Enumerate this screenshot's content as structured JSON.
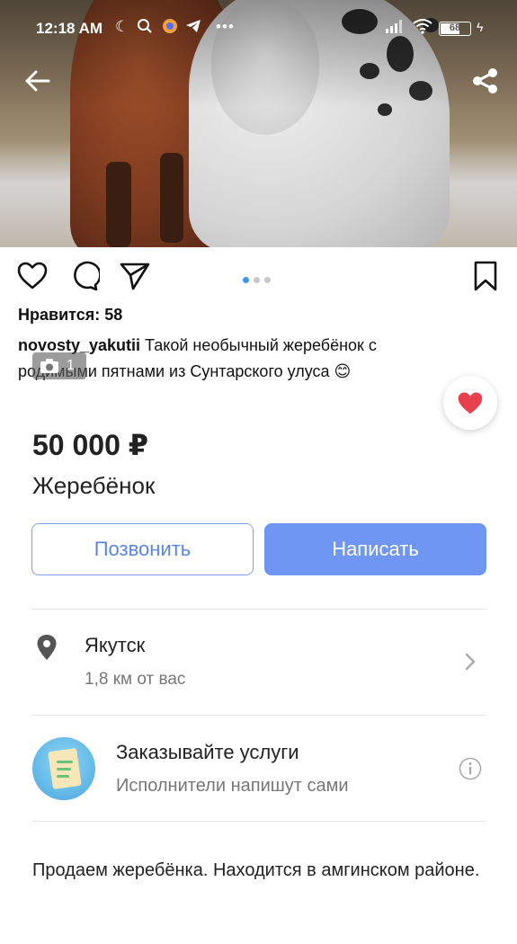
{
  "status_bar": {
    "time": "12:18 AM",
    "icons": [
      "moon-icon",
      "search-icon",
      "app-icon",
      "telegram-icon",
      "more-icon",
      "signal-icon",
      "wifi-icon"
    ],
    "battery": "68",
    "battery_level_percent": 68
  },
  "hero": {
    "icons": [
      "back-arrow-icon",
      "share-icon"
    ]
  },
  "post": {
    "likes": "Нравится: 58",
    "username": "novosty_yakutii",
    "caption": " Такой необычный жеребёнок с родимыми пятнами из Сунтарского улуса 😊",
    "carousel_total": 3,
    "carousel_active": 1,
    "photo_count": "1"
  },
  "listing": {
    "price": "50 000 ₽",
    "title": "Жеребёнок",
    "call_label": "Позвонить",
    "write_label": "Написать",
    "location": {
      "city": "Якутск",
      "distance": "1,8 км от вас"
    },
    "service": {
      "title": "Заказывайте услуги",
      "subtitle": "Исполнители напишут сами"
    },
    "description": "Продаем жеребёнка. Находится в амгинском районе."
  },
  "colors": {
    "accent_blue": "#6e96f2",
    "outline_blue": "#7ea1ee",
    "favorite_red": "#e8414d",
    "carousel_active": "#3897f0"
  }
}
